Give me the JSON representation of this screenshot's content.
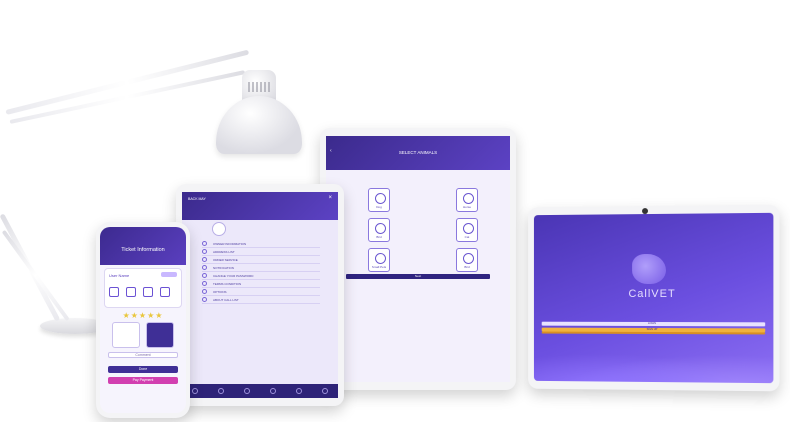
{
  "phone": {
    "header_title": "Ticket Information",
    "user_name": "User Name",
    "stars": "★★★★★",
    "field_label": "Comment",
    "done_label": "Done",
    "pay_label": "Pay Payment"
  },
  "tablet_menu": {
    "back_label": "BACK MAY",
    "close_icon": "×",
    "items": [
      "OWNER INFORMATION",
      "ADDRESS LIST",
      "ORDER SERVICE",
      "NOTIFICATION",
      "CHANGE YOUR PASSWORD",
      "TERMS CONDITION",
      "OPTIONS",
      "ABOUT CALL LIST"
    ]
  },
  "tablet_animals": {
    "title": "SELECT ANIMALS",
    "back_icon": "‹",
    "animals": [
      "Dog",
      "Horse",
      "Bird",
      "Cat",
      "Small Pets",
      "Bird"
    ],
    "next_label": "Next"
  },
  "tablet_splash": {
    "brand": "CallVET",
    "login_label": "LOGIN",
    "signup_label": "SIGN UP"
  },
  "colors": {
    "primary": "#4a35b4",
    "accent": "#d23fb0",
    "highlight": "#f0b23e"
  }
}
